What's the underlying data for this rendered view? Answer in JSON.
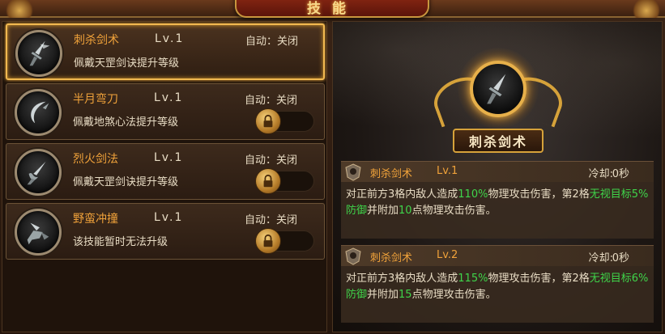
{
  "header": {
    "title": "技能"
  },
  "skills": [
    {
      "name": "刺杀剑术",
      "level": "Lv.1",
      "auto": "自动：关闭",
      "desc": "佩戴天罡剑诀提升等级",
      "icon": "sword-thrust-icon",
      "locked": false
    },
    {
      "name": "半月弯刀",
      "level": "Lv.1",
      "auto": "自动：关闭",
      "desc": "佩戴地煞心法提升等级",
      "icon": "crescent-blade-icon",
      "locked": true
    },
    {
      "name": "烈火剑法",
      "level": "Lv.1",
      "auto": "自动：关闭",
      "desc": "佩戴天罡剑诀提升等级",
      "icon": "flame-sword-icon",
      "locked": true
    },
    {
      "name": "野蛮冲撞",
      "level": "Lv.1",
      "auto": "自动：关闭",
      "desc": "该技能暂时无法升级",
      "icon": "charge-icon",
      "locked": true
    }
  ],
  "detail": {
    "name": "刺杀剑术",
    "levels": [
      {
        "name": "刺杀剑术",
        "level": "Lv.1",
        "cooldown_label": "冷却:",
        "cooldown_value": "0秒",
        "t1": "对正前方3格内敌人造成",
        "v1": "110%",
        "t2": "物理攻击伤害，第2格",
        "v2": "无视目标5%防御",
        "t3": "并附加",
        "v3": "10",
        "t4": "点物理攻击伤害。"
      },
      {
        "name": "刺杀剑术",
        "level": "Lv.2",
        "cooldown_label": "冷却:",
        "cooldown_value": "0秒",
        "t1": "对正前方3格内敌人造成",
        "v1": "115%",
        "t2": "物理攻击伤害，第2格",
        "v2": "无视目标6%防御",
        "t3": "并附加",
        "v3": "15",
        "t4": "点物理攻击伤害。"
      }
    ]
  },
  "colors": {
    "accent": "#f0a23a",
    "highlight": "#3fd44a",
    "gold": "#d6a23a"
  }
}
